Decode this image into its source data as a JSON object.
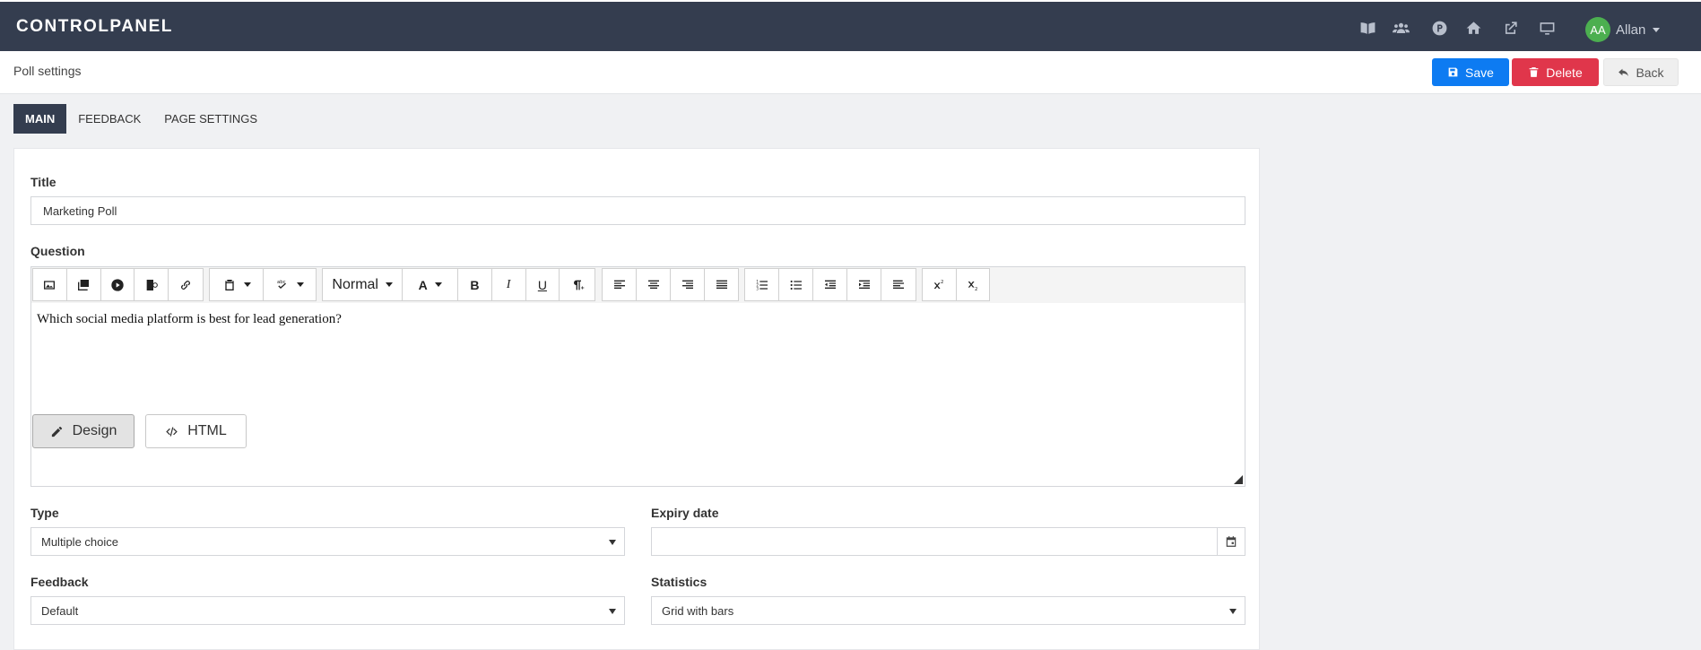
{
  "app": {
    "brand": "CONTROLPANEL"
  },
  "topbar": {
    "icons": [
      "book-icon",
      "users-icon",
      "poll-icon",
      "home-icon",
      "external-link-icon",
      "monitor-icon"
    ],
    "user": {
      "initials": "AA",
      "name": "Allan",
      "avatar_color": "#4caf50"
    }
  },
  "header": {
    "title": "Poll settings",
    "save_label": "Save",
    "delete_label": "Delete",
    "back_label": "Back"
  },
  "tabs": [
    {
      "label": "MAIN",
      "active": true
    },
    {
      "label": "FEEDBACK",
      "active": false
    },
    {
      "label": "PAGE SETTINGS",
      "active": false
    }
  ],
  "form": {
    "title_label": "Title",
    "title_value": "Marketing Poll",
    "question_label": "Question",
    "question_text": "Which social media platform is best for lead generation?",
    "editor": {
      "format_value": "Normal",
      "font_color_label": "A",
      "bold_label": "B",
      "italic_label": "I",
      "underline_label": "U",
      "design_label": "Design",
      "html_label": "HTML"
    },
    "type_label": "Type",
    "type_value": "Multiple choice",
    "expiry_label": "Expiry date",
    "expiry_value": "",
    "feedback_label": "Feedback",
    "feedback_value": "Default",
    "statistics_label": "Statistics",
    "statistics_value": "Grid with bars"
  },
  "colors": {
    "navbar": "#343d4f",
    "save": "#0d7bf2",
    "delete": "#e0364b"
  }
}
